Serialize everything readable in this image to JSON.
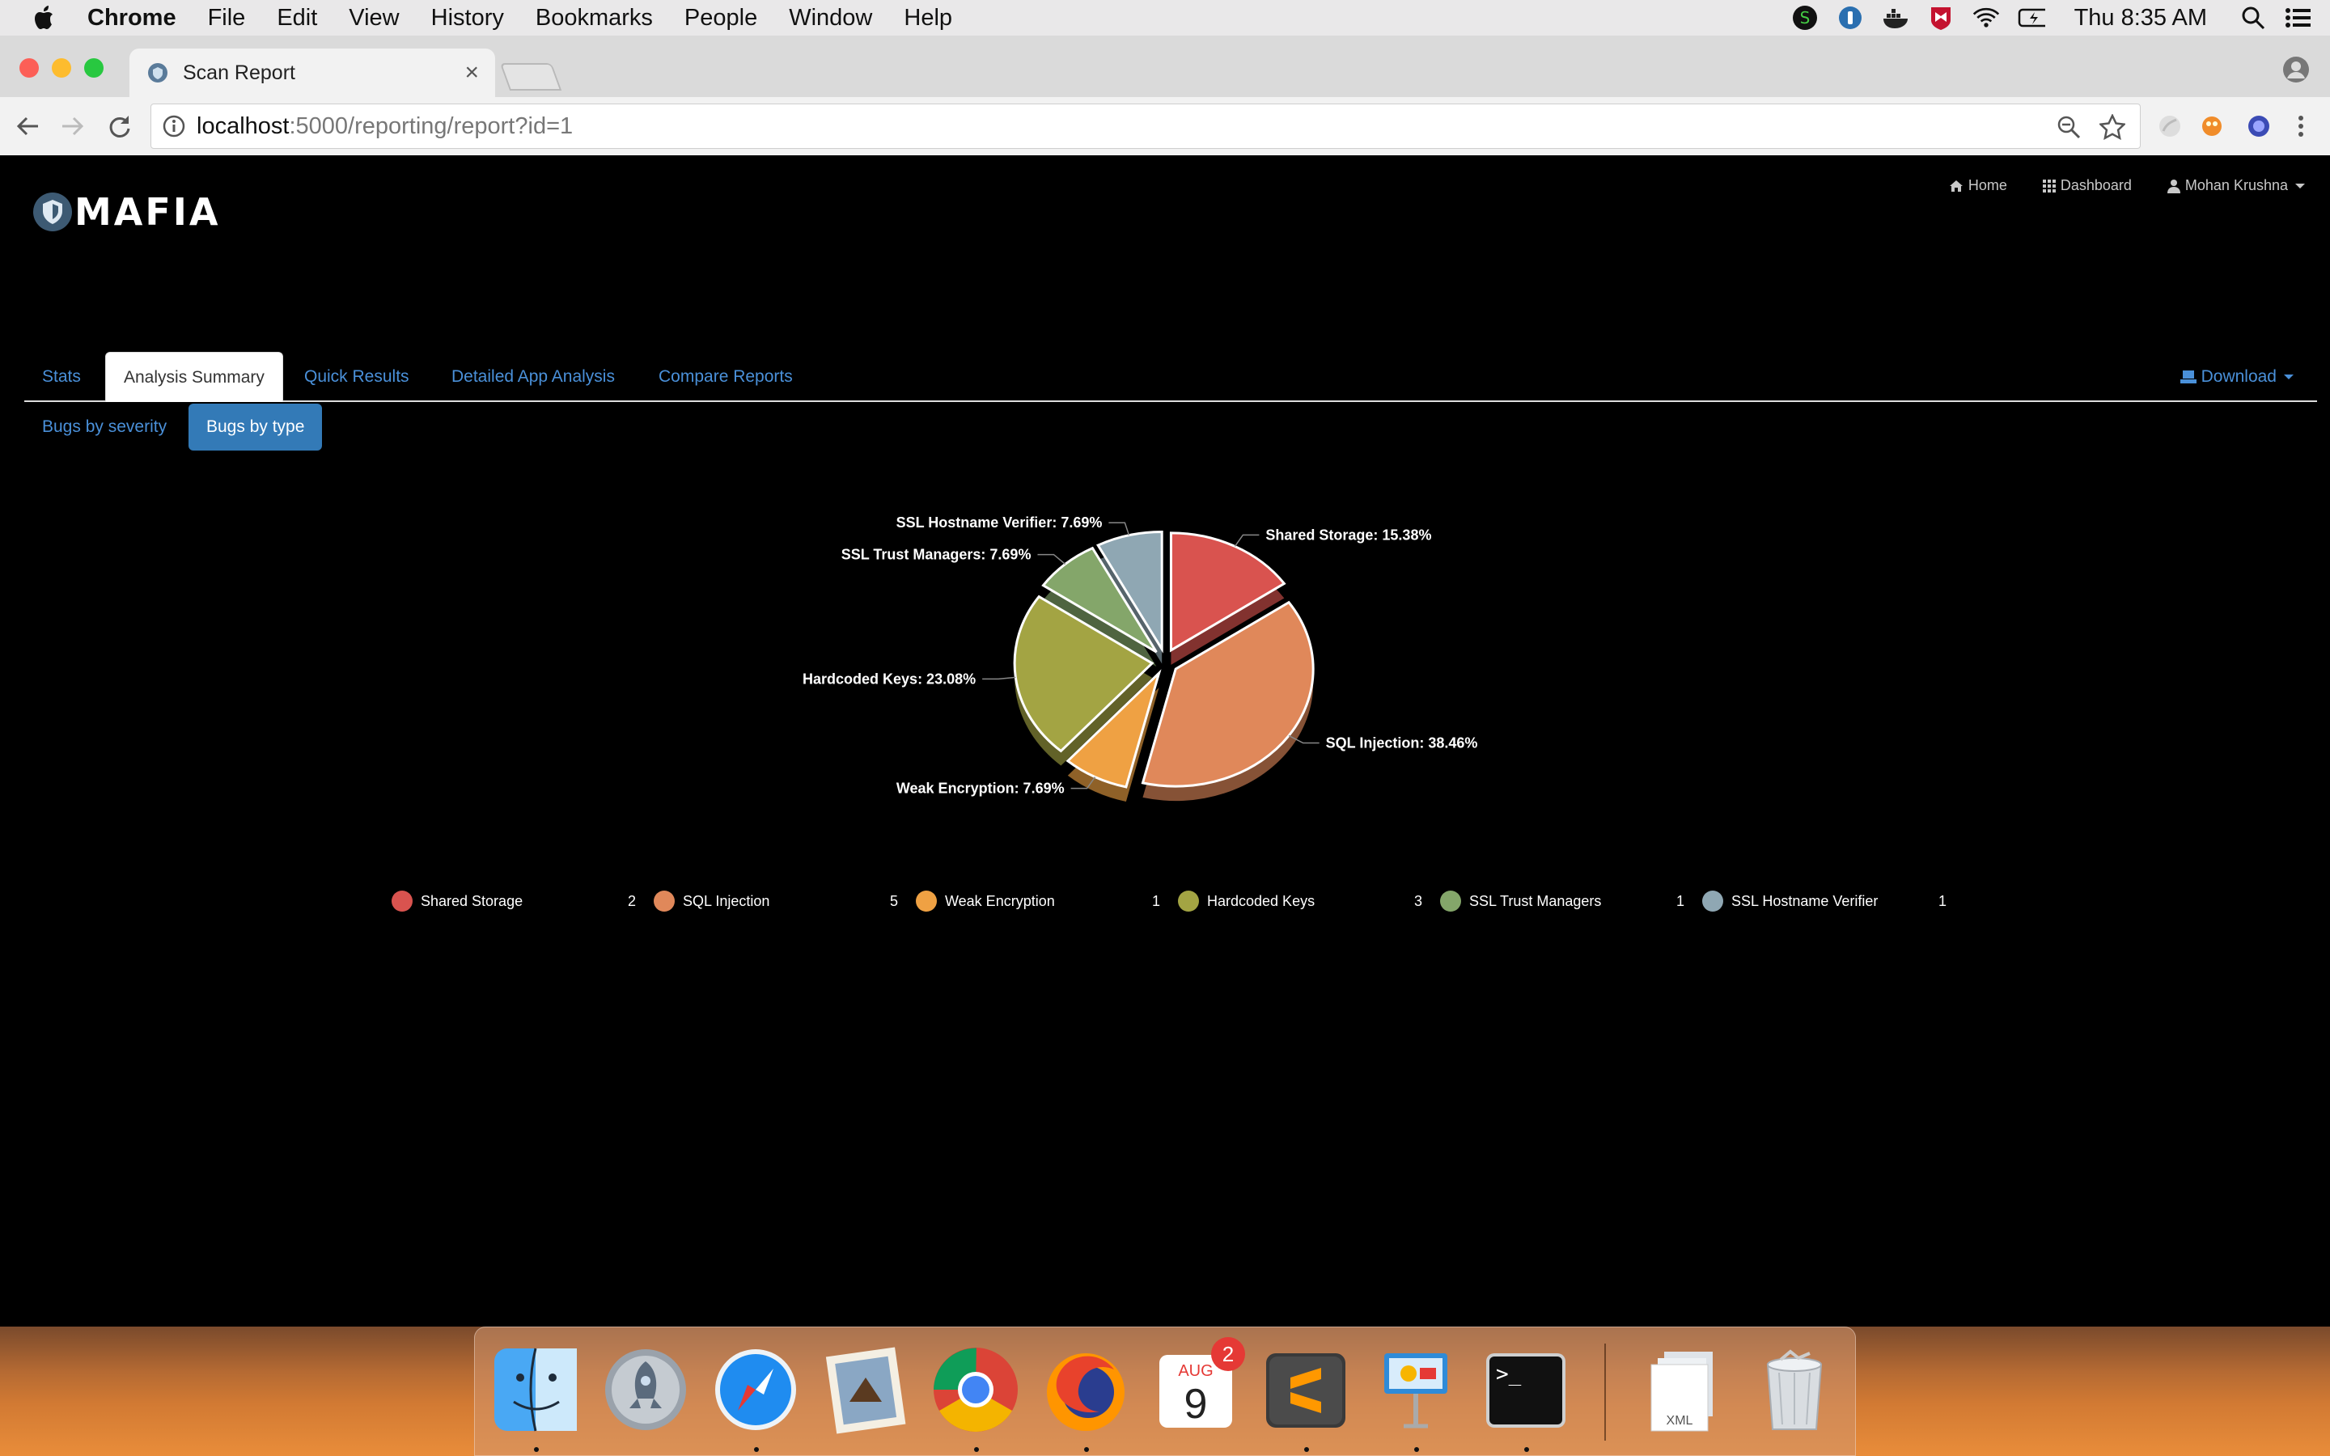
{
  "menubar": {
    "app_name": "Chrome",
    "items": [
      "File",
      "Edit",
      "View",
      "History",
      "Bookmarks",
      "People",
      "Window",
      "Help"
    ],
    "clock": "Thu 8:35 AM",
    "status_icons": [
      "skype-icon",
      "1password-icon",
      "docker-icon",
      "mcafee-icon",
      "wifi-icon",
      "battery-icon",
      "spotlight-icon",
      "notification-center-icon"
    ]
  },
  "browser": {
    "tab_title": "Scan Report",
    "url_host": "localhost",
    "url_rest": ":5000/reporting/report?id=1"
  },
  "app": {
    "logo_text": "MAFIA",
    "nav": {
      "home": "Home",
      "dashboard": "Dashboard",
      "user": "Mohan Krushna"
    },
    "tabs": [
      "Stats",
      "Analysis Summary",
      "Quick Results",
      "Detailed App Analysis",
      "Compare Reports"
    ],
    "active_tab": "Analysis Summary",
    "download_label": "Download",
    "pills": {
      "severity": "Bugs by severity",
      "type": "Bugs by type"
    }
  },
  "chart_data": {
    "type": "pie",
    "categories": [
      "Shared Storage",
      "SQL Injection",
      "Weak Encryption",
      "Hardcoded Keys",
      "SSL Trust Managers",
      "SSL Hostname Verifier"
    ],
    "values": [
      2,
      5,
      1,
      3,
      1,
      1
    ],
    "percent_labels": [
      "Shared Storage: 15.38%",
      "SQL Injection: 38.46%",
      "Weak Encryption: 7.69%",
      "Hardcoded Keys: 23.08%",
      "SSL Trust Managers: 7.69%",
      "SSL Hostname Verifier: 7.69%"
    ],
    "colors": [
      "#d9534f",
      "#e0885a",
      "#efa143",
      "#a3a443",
      "#84a66a",
      "#8fa7b3"
    ],
    "legend_placement": "bottom"
  },
  "dock": {
    "apps": [
      "finder-icon",
      "launchpad-icon",
      "safari-icon",
      "mail-icon",
      "chrome-icon",
      "firefox-icon",
      "calendar-icon",
      "sublime-text-icon",
      "keynote-icon",
      "terminal-icon",
      "xml-folder-icon",
      "trash-icon"
    ],
    "calendar_month": "AUG",
    "calendar_day": "9",
    "calendar_badge": "2",
    "xml_label": "XML"
  }
}
